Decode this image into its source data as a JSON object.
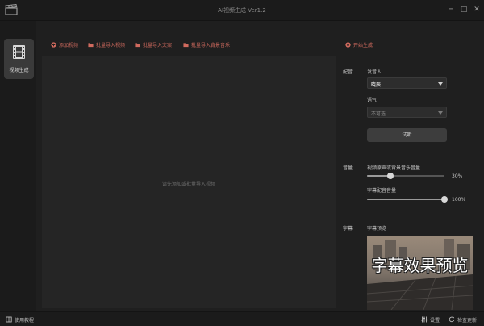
{
  "window": {
    "title": "AI视频生成 Ver1.2",
    "controls": {
      "minimize": "─",
      "maximize": "□",
      "close": "✕"
    }
  },
  "sidebar": {
    "items": [
      {
        "label": "视频生成",
        "icon": "film-icon",
        "selected": true
      }
    ]
  },
  "toolbar": {
    "add_video": "添加视频",
    "batch_import_video": "批量导入视频",
    "batch_import_text": "批量导入文案",
    "batch_import_music": "批量导入背景音乐",
    "start_generate": "开始生成",
    "accent_color": "#d06a5e"
  },
  "main": {
    "empty_hint": "请先添加或批量导入视频"
  },
  "panel": {
    "voice": {
      "section_label": "配音",
      "speaker_label": "发音人",
      "speaker_value": "晓辰",
      "tone_label": "语气",
      "tone_value": "不可选",
      "audition_button": "试听"
    },
    "volume": {
      "section_label": "音量",
      "bg_label": "视频原声或背景音乐音量",
      "bg_value": 30,
      "bg_text": "30%",
      "voice_label": "字幕配音音量",
      "voice_value": 100,
      "voice_text": "100%"
    },
    "subtitle": {
      "section_label": "字幕",
      "preview_label": "字幕预览",
      "preview_text": "字幕效果预览"
    }
  },
  "bottom": {
    "help": "使用教程",
    "settings": "设置",
    "update": "检查更新"
  }
}
